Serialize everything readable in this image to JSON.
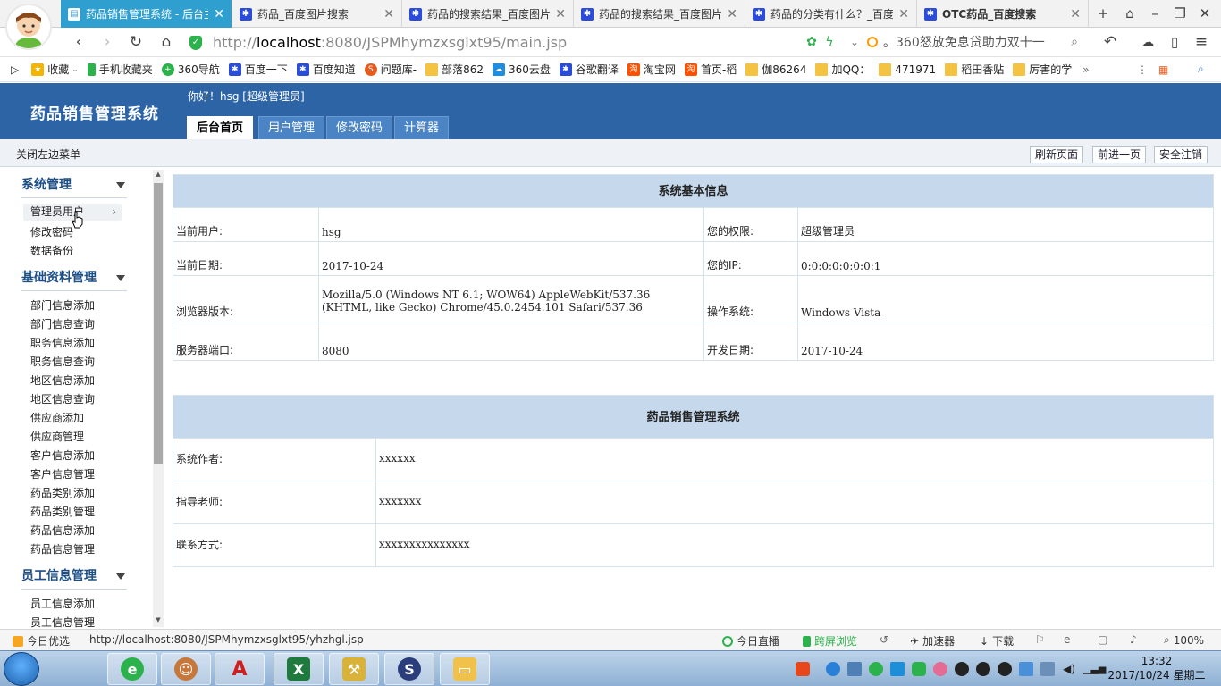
{
  "browser": {
    "tabs": [
      {
        "label": "药品销售管理系统 - 后台主",
        "active": true
      },
      {
        "label": "药品_百度图片搜索",
        "active": false
      },
      {
        "label": "药品的搜索结果_百度图片",
        "active": false
      },
      {
        "label": "药品的搜索结果_百度图片",
        "active": false
      },
      {
        "label": "药品的分类有什么？_百度",
        "active": false
      },
      {
        "label": "OTC药品_百度搜索",
        "active": false
      }
    ],
    "url_prefix": "http://",
    "url_host": "localhost",
    "url_path": ":8080/JSPMhymzxsglxt95/main.jsp",
    "search_text": "。360怒放免息贷助力双十一",
    "bookmarks": [
      {
        "label": "收藏",
        "icon": "star-icon"
      },
      {
        "label": "手机收藏夹",
        "icon": "phone-icon"
      },
      {
        "label": "360导航",
        "icon": "plus-icon"
      },
      {
        "label": "百度一下",
        "icon": "paw-icon"
      },
      {
        "label": "百度知道",
        "icon": "paw-icon"
      },
      {
        "label": "问题库-",
        "icon": "s-icon"
      },
      {
        "label": "部落862",
        "icon": "folder-icon"
      },
      {
        "label": "360云盘",
        "icon": "cloud-icon"
      },
      {
        "label": "谷歌翻译",
        "icon": "paw-icon"
      },
      {
        "label": "淘宝网",
        "icon": "taobao-icon"
      },
      {
        "label": "首页-稻",
        "icon": "taobao-icon"
      },
      {
        "label": "伽86264",
        "icon": "folder-icon"
      },
      {
        "label": "加QQ：",
        "icon": "folder-icon"
      },
      {
        "label": "471971",
        "icon": "folder-icon"
      },
      {
        "label": "稻田香贴",
        "icon": "folder-icon"
      },
      {
        "label": "厉害的学",
        "icon": "folder-icon"
      }
    ]
  },
  "app": {
    "title": "药品销售管理系统",
    "greeting": "你好！hsg [超级管理员]",
    "tabs": [
      {
        "label": "后台首页",
        "active": true
      },
      {
        "label": "用户管理",
        "active": false
      },
      {
        "label": "修改密码",
        "active": false
      },
      {
        "label": "计算器",
        "active": false
      }
    ],
    "toolbar": {
      "toggle_left": "关闭左边菜单",
      "refresh": "刷新页面",
      "forward": "前进一页",
      "logout": "安全注销"
    }
  },
  "sidebar": {
    "groups": [
      {
        "title": "系统管理",
        "items": [
          "管理员用户",
          "修改密码",
          "数据备份"
        ]
      },
      {
        "title": "基础资料管理",
        "items": [
          "部门信息添加",
          "部门信息查询",
          "职务信息添加",
          "职务信息查询",
          "地区信息添加",
          "地区信息查询",
          "供应商添加",
          "供应商管理",
          "客户信息添加",
          "客户信息管理",
          "药品类别添加",
          "药品类别管理",
          "药品信息添加",
          "药品信息管理"
        ]
      },
      {
        "title": "员工信息管理",
        "items": [
          "员工信息添加",
          "员工信息管理"
        ]
      }
    ]
  },
  "system_info": {
    "title": "系统基本信息",
    "current_user_label": "当前用户:",
    "current_user": "hsg",
    "permission_label": "您的权限:",
    "permission": "超级管理员",
    "date_label": "当前日期:",
    "date": "2017-10-24",
    "ip_label": "您的IP:",
    "ip": "0:0:0:0:0:0:0:1",
    "browser_label": "浏览器版本:",
    "browser": "Mozilla/5.0 (Windows NT 6.1; WOW64) AppleWebKit/537.36 (KHTML, like Gecko) Chrome/45.0.2454.101 Safari/537.36",
    "os_label": "操作系统:",
    "os": "Windows Vista",
    "port_label": "服务器端口:",
    "port": "8080",
    "dev_date_label": "开发日期:",
    "dev_date": "2017-10-24"
  },
  "about": {
    "title": "药品销售管理系统",
    "author_label": "系统作者:",
    "author": "xxxxxx",
    "teacher_label": "指导老师:",
    "teacher": "xxxxxxx",
    "contact_label": "联系方式:",
    "contact": "xxxxxxxxxxxxxxx"
  },
  "statusbar": {
    "left": "今日优选",
    "link": "http://localhost:8080/JSPMhymzxsglxt95/yhzhgl.jsp",
    "live": "今日直播",
    "cross": "跨屏浏览",
    "accel": "加速器",
    "download": "下载",
    "zoom": "100%"
  },
  "taskbar": {
    "time": "13:32",
    "date": "2017/10/24 星期二"
  }
}
